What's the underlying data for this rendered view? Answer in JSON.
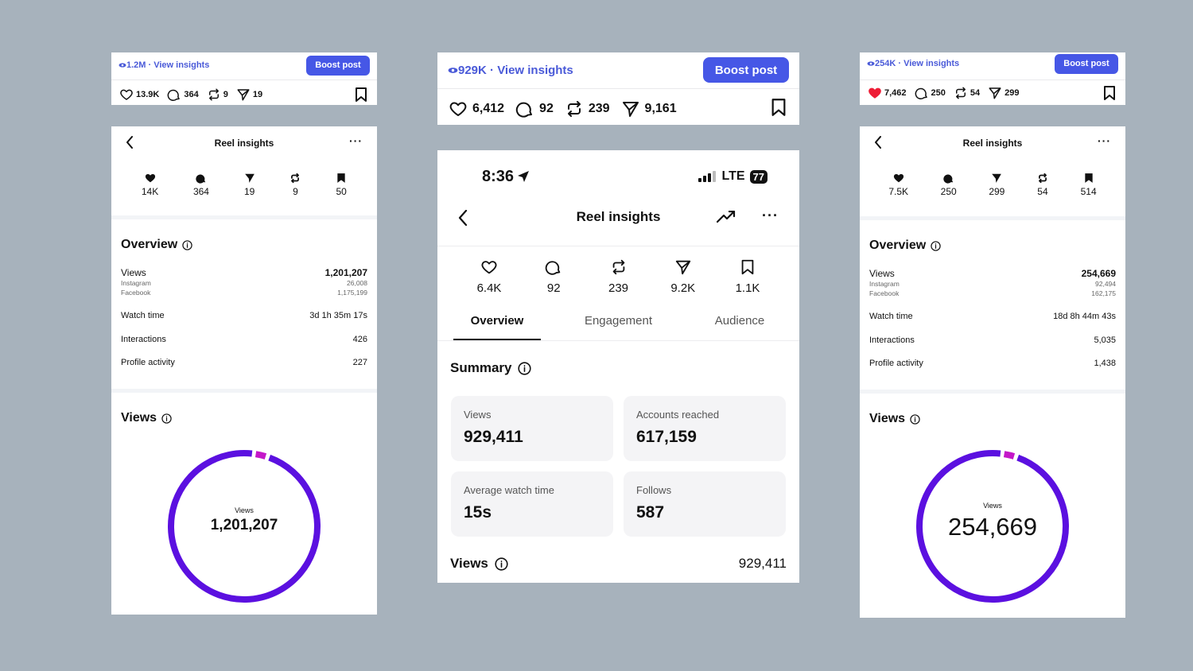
{
  "left": {
    "post": {
      "views_link": "1.2M · View insights",
      "boost_label": "Boost post",
      "likes": "13.9K",
      "comments": "364",
      "reposts": "9",
      "shares": "19"
    },
    "insights": {
      "title": "Reel insights",
      "stats": {
        "likes": "14K",
        "comments": "364",
        "shares": "19",
        "reposts": "9",
        "saves": "50"
      },
      "overview_title": "Overview",
      "views_label": "Views",
      "views_value": "1,201,207",
      "instagram_label": "Instagram",
      "instagram_value": "26,008",
      "facebook_label": "Facebook",
      "facebook_value": "1,175,199",
      "watch_time_label": "Watch time",
      "watch_time_value": "3d 1h 35m 17s",
      "interactions_label": "Interactions",
      "interactions_value": "426",
      "profile_activity_label": "Profile activity",
      "profile_activity_value": "227",
      "views_section_title": "Views",
      "donut": {
        "center_label": "Views",
        "center_value": "1,201,207",
        "main_color": "#5b10e0",
        "accent_color": "#c417c9",
        "accent_fraction": 0.022
      }
    }
  },
  "middle": {
    "post": {
      "views_link": "929K · View insights",
      "boost_label": "Boost post",
      "likes": "6,412",
      "comments": "92",
      "reposts": "239",
      "shares": "9,161"
    },
    "phone": {
      "time": "8:36",
      "network": "LTE",
      "battery": "77",
      "title": "Reel insights",
      "stats": {
        "likes": "6.4K",
        "comments": "92",
        "reposts": "239",
        "shares": "9.2K",
        "saves": "1.1K"
      },
      "tabs": [
        "Overview",
        "Engagement",
        "Audience"
      ],
      "summary_title": "Summary",
      "tiles": [
        {
          "label": "Views",
          "value": "929,411"
        },
        {
          "label": "Accounts reached",
          "value": "617,159"
        },
        {
          "label": "Average watch time",
          "value": "15s"
        },
        {
          "label": "Follows",
          "value": "587"
        }
      ],
      "views_label": "Views",
      "views_value": "929,411"
    }
  },
  "right": {
    "post": {
      "views_link": "254K · View insights",
      "boost_label": "Boost post",
      "likes": "7,462",
      "comments": "250",
      "reposts": "54",
      "shares": "299",
      "like_color": "#ee1d36"
    },
    "insights": {
      "title": "Reel insights",
      "stats": {
        "likes": "7.5K",
        "comments": "250",
        "shares": "299",
        "reposts": "54",
        "saves": "514"
      },
      "overview_title": "Overview",
      "views_label": "Views",
      "views_value": "254,669",
      "instagram_label": "Instagram",
      "instagram_value": "92,494",
      "facebook_label": "Facebook",
      "facebook_value": "162,175",
      "watch_time_label": "Watch time",
      "watch_time_value": "18d 8h 44m 43s",
      "interactions_label": "Interactions",
      "interactions_value": "5,035",
      "profile_activity_label": "Profile activity",
      "profile_activity_value": "1,438",
      "views_section_title": "Views",
      "donut": {
        "center_label": "Views",
        "center_value": "254,669",
        "main_color": "#5b10e0",
        "accent_color": "#c417c9",
        "accent_fraction": 0.022
      }
    }
  }
}
